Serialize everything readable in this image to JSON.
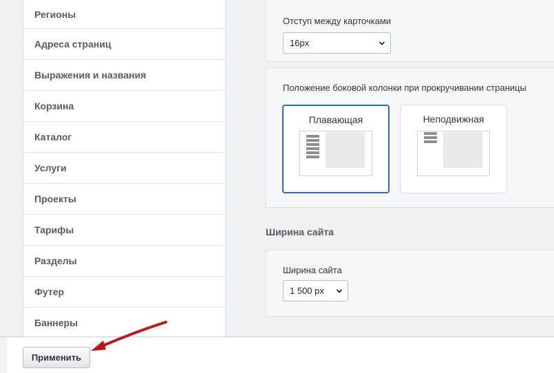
{
  "sidebar": {
    "items": [
      {
        "label": "Регионы"
      },
      {
        "label": "Адреса страниц"
      },
      {
        "label": "Выражения и названия"
      },
      {
        "label": "Корзина"
      },
      {
        "label": "Каталог"
      },
      {
        "label": "Услуги"
      },
      {
        "label": "Проекты"
      },
      {
        "label": "Тарифы"
      },
      {
        "label": "Разделы"
      },
      {
        "label": "Футер"
      },
      {
        "label": "Баннеры"
      }
    ]
  },
  "card_spacing": {
    "label": "Отступ между карточками",
    "value": "16px"
  },
  "sidebar_position": {
    "label": "Положение боковой колонки при прокручивании страницы",
    "options": [
      {
        "title": "Плавающая",
        "selected": true
      },
      {
        "title": "Неподвижная",
        "selected": false
      }
    ]
  },
  "site_width": {
    "section_title": "Ширина сайта",
    "label": "Ширина сайта",
    "value": "1 500 px"
  },
  "footer": {
    "apply_label": "Применить"
  },
  "colors": {
    "selected_border": "#2d6bb8",
    "arrow": "#c0161c"
  },
  "icons": [
    "chevron-down-icon",
    "arrow-pointer-icon"
  ]
}
